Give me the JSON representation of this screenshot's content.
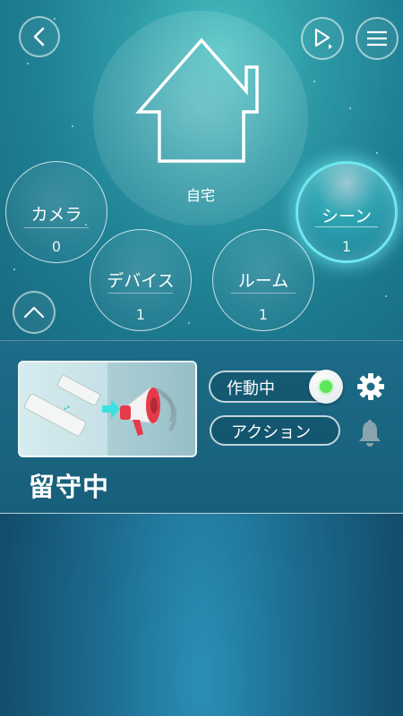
{
  "header": {
    "back_icon": "chevron-left-icon",
    "play_icon": "play-icon",
    "menu_icon": "hamburger-menu-icon"
  },
  "home": {
    "label": "自宅",
    "icon": "house-icon"
  },
  "categories": [
    {
      "label": "カメラ",
      "count": "0"
    },
    {
      "label": "デバイス",
      "count": "1"
    },
    {
      "label": "ルーム",
      "count": "1"
    },
    {
      "label": "シーン",
      "count": "1"
    }
  ],
  "collapse_icon": "chevron-up-icon",
  "scene": {
    "thumbnail": "sensor-to-siren-scene",
    "status_label": "作動中",
    "status_on": true,
    "status_indicator_color": "#5be85b",
    "action_label": "アクション",
    "mode_name": "留守中",
    "settings_icon": "gear-icon",
    "bell_icon": "bell-icon"
  }
}
